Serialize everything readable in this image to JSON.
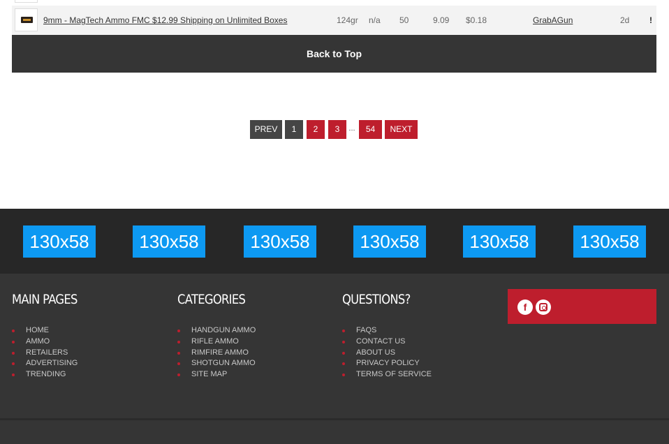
{
  "deal": {
    "title": "9mm - MagTech Ammo FMC $12.99 Shipping on Unlimited Boxes",
    "grain": "124gr",
    "type": "n/a",
    "quantity": "50",
    "price": "9.09",
    "cost_per_round": "$0.18",
    "retailer": "GrabAGun",
    "age": "2d",
    "flag": "!"
  },
  "back_to_top": "Back to Top",
  "pagination": {
    "prev": "PREV",
    "pages": [
      "1",
      "2",
      "3"
    ],
    "ellipsis": "...",
    "last": "54",
    "next": "NEXT",
    "current": "1"
  },
  "ads": [
    "130x58",
    "130x58",
    "130x58",
    "130x58",
    "130x58",
    "130x58"
  ],
  "footer": {
    "main_pages": {
      "title": "MAIN PAGES",
      "items": [
        "HOME",
        "AMMO",
        "RETAILERS",
        "ADVERTISING",
        "TRENDING"
      ]
    },
    "categories": {
      "title": "CATEGORIES",
      "items": [
        "HANDGUN AMMO",
        "RIFLE AMMO",
        "RIMFIRE AMMO",
        "SHOTGUN AMMO",
        "SITE MAP"
      ]
    },
    "questions": {
      "title": "QUESTIONS?",
      "items": [
        "FAQS",
        "CONTACT US",
        "ABOUT US",
        "PRIVACY POLICY",
        "TERMS OF SERVICE"
      ]
    },
    "social": [
      "facebook-icon",
      "instagram-icon"
    ]
  },
  "colors": {
    "accent_red": "#be1e2d",
    "ad_blue": "#0d99f2",
    "footer_dark": "#353535"
  }
}
